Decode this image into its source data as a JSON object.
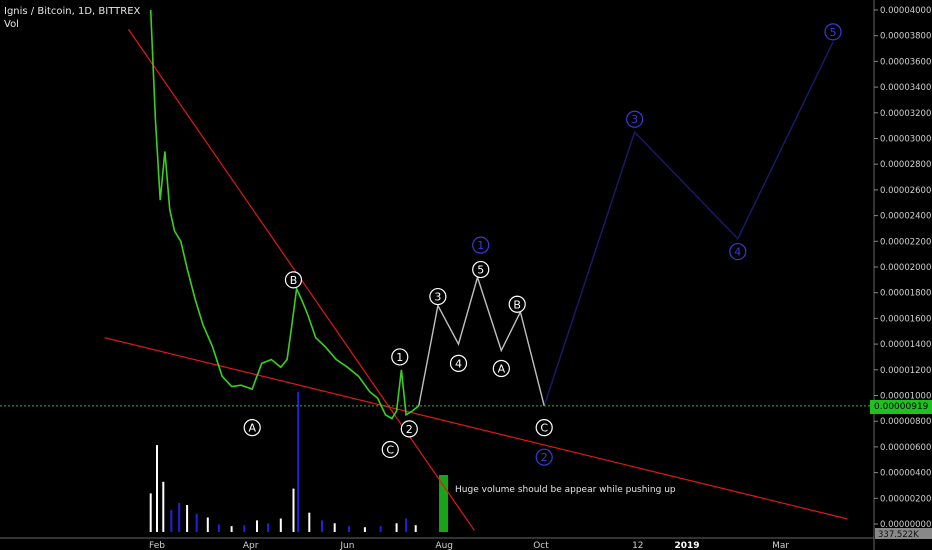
{
  "header": {
    "symbol": "Ignis / Bitcoin, 1D, BITTREX",
    "volume_label": "Vol"
  },
  "last_price": "0.00000919",
  "annotation": "Huge volume should be appear while pushing up",
  "volume_readout": "337.522K",
  "colors": {
    "background": "#000000",
    "price_line": "#3ad11e",
    "trend_lines": "#e01818",
    "projection_white": "#bfbfbf",
    "projection_blue": "#1a1a6e",
    "wave_blue": "#3a3ad8",
    "volume_up": "#ffffff",
    "volume_down": "#2020e0",
    "volume_marker": "#19a319"
  },
  "chart_data": {
    "type": "line",
    "title": "Ignis / Bitcoin, 1D, BITTREX",
    "xlabel": "",
    "ylabel": "",
    "x_ticks": [
      "Feb",
      "Apr",
      "Jun",
      "Aug",
      "Oct",
      "12",
      "2019",
      "Mar"
    ],
    "y_ticks": [
      "0.00004000",
      "0.00003800",
      "0.00003600",
      "0.00003400",
      "0.00003200",
      "0.00003000",
      "0.00002800",
      "0.00002600",
      "0.00002400",
      "0.00002200",
      "0.00002000",
      "0.00001800",
      "0.00001600",
      "0.00001400",
      "0.00001200",
      "0.00001000",
      "0.00000800",
      "0.00000600",
      "0.00000400",
      "0.00000200",
      "0.00000000"
    ],
    "ylim": [
      0,
      4e-05
    ],
    "grid": false,
    "series": [
      {
        "x": [
          "2018-01-28",
          "2018-01-31",
          "2018-02-03",
          "2018-02-06",
          "2018-02-09",
          "2018-02-12",
          "2018-02-16",
          "2018-02-20",
          "2018-02-25",
          "2018-03-02",
          "2018-03-08",
          "2018-03-14",
          "2018-03-20",
          "2018-03-26",
          "2018-04-02",
          "2018-04-08",
          "2018-04-14",
          "2018-04-20",
          "2018-04-24",
          "2018-04-27",
          "2018-04-30",
          "2018-05-03",
          "2018-05-07",
          "2018-05-12",
          "2018-05-18",
          "2018-05-25",
          "2018-06-01",
          "2018-06-08",
          "2018-06-15",
          "2018-06-20",
          "2018-06-25",
          "2018-06-29",
          "2018-07-02",
          "2018-07-05",
          "2018-07-08",
          "2018-07-12",
          "2018-07-16"
        ],
        "values": [
          4e-05,
          3.15e-05,
          2.52e-05,
          2.9e-05,
          2.45e-05,
          2.28e-05,
          2.2e-05,
          1.99e-05,
          1.75e-05,
          1.55e-05,
          1.38e-05,
          1.15e-05,
          1.07e-05,
          1.08e-05,
          1.05e-05,
          1.25e-05,
          1.28e-05,
          1.22e-05,
          1.28e-05,
          1.55e-05,
          1.83e-05,
          1.75e-05,
          1.63e-05,
          1.45e-05,
          1.38e-05,
          1.28e-05,
          1.22e-05,
          1.15e-05,
          1.03e-05,
          9.8e-06,
          8.5e-06,
          8.2e-06,
          8.8e-06,
          1.2e-05,
          8.5e-06,
          8.8e-06,
          9.2e-06
        ]
      }
    ],
    "trend_lines": [
      {
        "from": [
          "2018-01-14",
          3.85e-05
        ],
        "to": [
          "2018-08-20",
          -5e-07
        ]
      },
      {
        "from": [
          "2017-12-30",
          1.45e-05
        ],
        "to": [
          "2019-04-12",
          4e-07
        ]
      }
    ],
    "wave_projection_white": {
      "points": [
        [
          "2018-07-16",
          9.2e-06
        ],
        [
          "2018-07-28",
          1.7e-05
        ],
        [
          "2018-08-10",
          1.4e-05
        ],
        [
          "2018-08-22",
          1.92e-05
        ],
        [
          "2018-09-06",
          1.35e-05
        ],
        [
          "2018-09-18",
          1.65e-05
        ],
        [
          "2018-10-03",
          9.2e-06
        ]
      ],
      "labels": [
        {
          "text": "A",
          "x": "2018-04-02",
          "y": 7.5e-06
        },
        {
          "text": "B",
          "x": "2018-04-28",
          "y": 1.9e-05
        },
        {
          "text": "C",
          "x": "2018-06-28",
          "y": 5.8e-06
        },
        {
          "text": "1",
          "x": "2018-07-04",
          "y": 1.3e-05
        },
        {
          "text": "2",
          "x": "2018-07-10",
          "y": 7.4e-06
        },
        {
          "text": "3",
          "x": "2018-07-28",
          "y": 1.77e-05
        },
        {
          "text": "4",
          "x": "2018-08-10",
          "y": 1.25e-05
        },
        {
          "text": "5",
          "x": "2018-08-24",
          "y": 1.98e-05
        },
        {
          "text": "A",
          "x": "2018-09-06",
          "y": 1.21e-05
        },
        {
          "text": "B",
          "x": "2018-09-16",
          "y": 1.71e-05
        },
        {
          "text": "C",
          "x": "2018-10-03",
          "y": 7.5e-06
        }
      ]
    },
    "wave_projection_blue": {
      "points": [
        [
          "2018-10-03",
          9.2e-06
        ],
        [
          "2018-11-29",
          3.05e-05
        ],
        [
          "2019-02-02",
          2.22e-05
        ],
        [
          "2019-04-03",
          3.75e-05
        ]
      ],
      "labels": [
        {
          "text": "1",
          "x": "2018-08-24",
          "y": 2.17e-05
        },
        {
          "text": "2",
          "x": "2018-10-03",
          "y": 5.2e-06
        },
        {
          "text": "3",
          "x": "2018-11-29",
          "y": 3.15e-05
        },
        {
          "text": "4",
          "x": "2019-02-02",
          "y": 2.12e-05
        },
        {
          "text": "5",
          "x": "2019-04-03",
          "y": 3.83e-05
        }
      ]
    },
    "volume": {
      "x": [
        "2018-01-28",
        "2018-02-01",
        "2018-02-05",
        "2018-02-10",
        "2018-02-15",
        "2018-02-20",
        "2018-02-26",
        "2018-03-05",
        "2018-03-12",
        "2018-03-20",
        "2018-03-28",
        "2018-04-05",
        "2018-04-12",
        "2018-04-20",
        "2018-04-28",
        "2018-05-01",
        "2018-05-08",
        "2018-05-16",
        "2018-05-24",
        "2018-06-02",
        "2018-06-12",
        "2018-06-22",
        "2018-07-02",
        "2018-07-08",
        "2018-07-14"
      ],
      "values": [
        400,
        900,
        520,
        230,
        300,
        280,
        190,
        150,
        80,
        60,
        70,
        120,
        90,
        140,
        450,
        1450,
        200,
        120,
        90,
        60,
        50,
        60,
        90,
        140,
        70
      ],
      "direction": [
        "up",
        "up",
        "up",
        "down",
        "down",
        "up",
        "down",
        "up",
        "down",
        "up",
        "down",
        "up",
        "down",
        "up",
        "up",
        "down",
        "up",
        "down",
        "up",
        "down",
        "up",
        "down",
        "up",
        "down",
        "up"
      ]
    },
    "annotations": [
      {
        "text": "Huge volume should be appear while pushing up",
        "x": "2018-07-30"
      }
    ]
  }
}
